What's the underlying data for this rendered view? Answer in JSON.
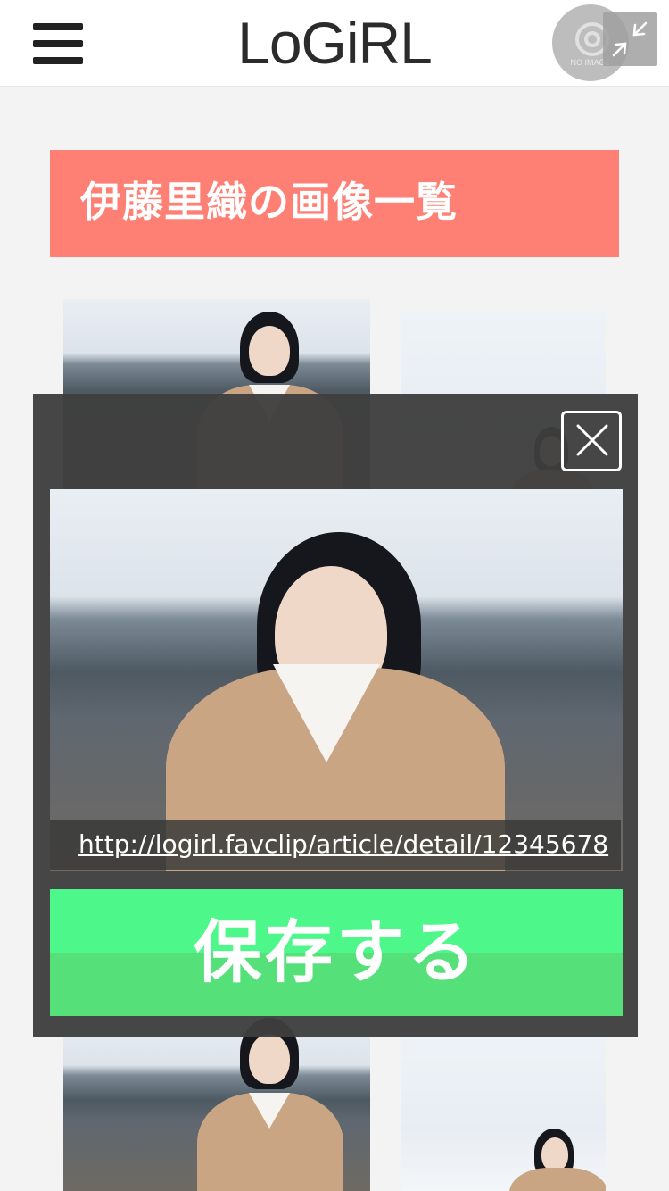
{
  "header": {
    "logo": "LoGiRL",
    "menu_icon": "hamburger-menu-icon",
    "no_image_text": "NO IMAGE",
    "resize_icon": "shrink-arrows-icon"
  },
  "page": {
    "title": "伊藤里織の画像一覧"
  },
  "gallery": {
    "items": [
      "photo-1",
      "photo-2",
      "photo-3",
      "photo-4"
    ]
  },
  "modal": {
    "close_icon": "close-icon",
    "url": "http://logirl.favclip/article/detail/12345678",
    "save_label": "保存する"
  },
  "colors": {
    "title_bg": "#fe7f74",
    "save_bg": "#4ef78a",
    "overlay_bg": "#3e3e3e"
  }
}
